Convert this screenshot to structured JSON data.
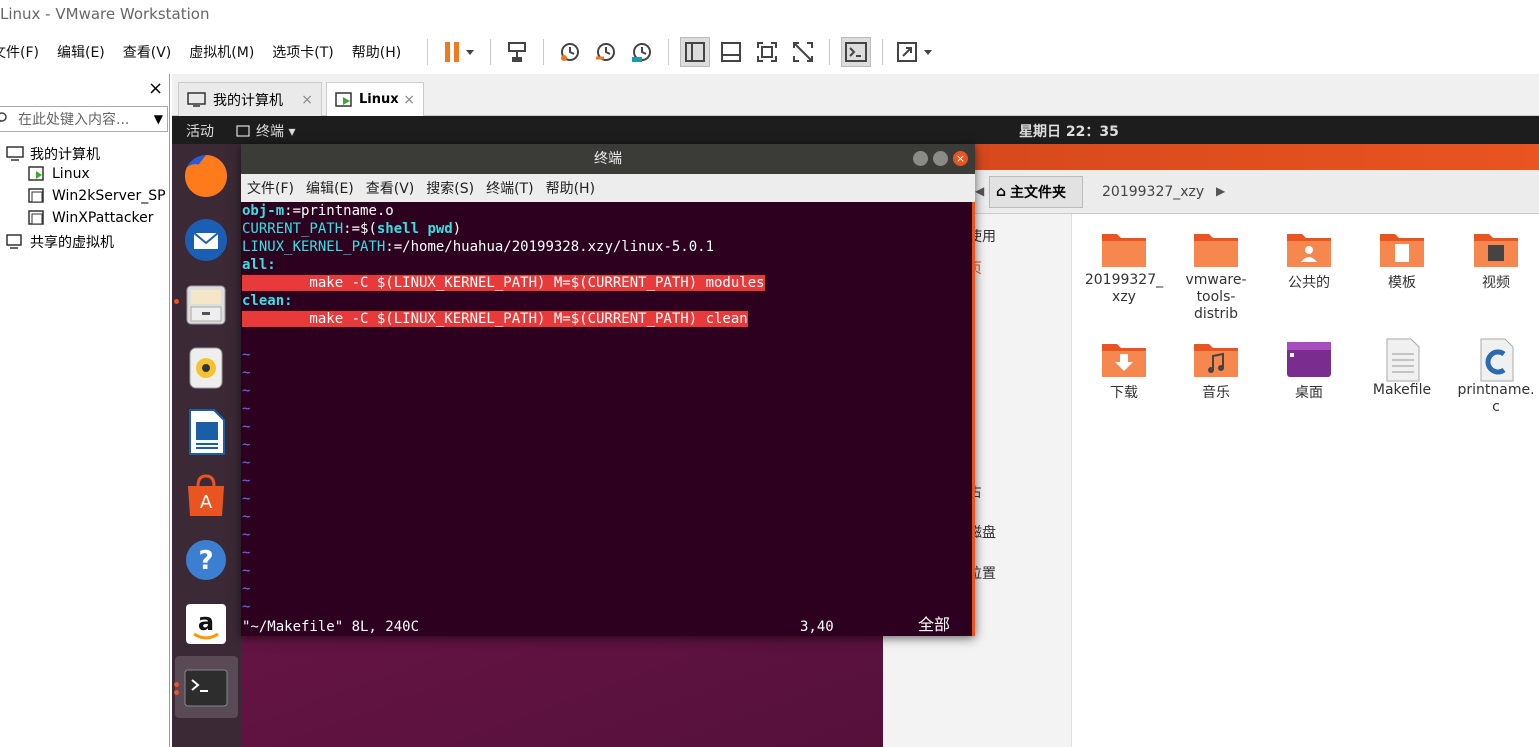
{
  "window": {
    "title": "Linux - VMware Workstation"
  },
  "menu": [
    "文件(F)",
    "编辑(E)",
    "查看(V)",
    "虚拟机(M)",
    "选项卡(T)",
    "帮助(H)"
  ],
  "library": {
    "close": "×",
    "search_placeholder": "在此处键入内容...",
    "items": [
      "我的计算机",
      "Linux",
      "Win2kServer_SP",
      "WinXPattacker",
      "共享的虚拟机"
    ]
  },
  "tabs": [
    {
      "label": "我的计算机",
      "close": "×"
    },
    {
      "label": "Linux",
      "close": "×"
    }
  ],
  "ubuntu": {
    "activities": "活动",
    "app_menu": "终端 ▾",
    "clock": "星期日 22：35"
  },
  "terminal": {
    "title": "终端",
    "menu": [
      "文件(F)",
      "编辑(E)",
      "查看(V)",
      "搜索(S)",
      "终端(T)",
      "帮助(H)"
    ],
    "lines": [
      {
        "parts": [
          {
            "t": "obj-m",
            "c": "kw"
          },
          {
            "t": ":=printname.o",
            "c": ""
          }
        ]
      },
      {
        "parts": [
          {
            "t": "CURRENT_PATH",
            "c": "vv"
          },
          {
            "t": ":=$(",
            "c": ""
          },
          {
            "t": "shell pwd",
            "c": "kw"
          },
          {
            "t": ")",
            "c": ""
          }
        ]
      },
      {
        "parts": [
          {
            "t": "LINUX_KERNEL_PATH",
            "c": "vv"
          },
          {
            "t": ":=/home/huahua/20199328.xzy/linux-5.0.1",
            "c": ""
          }
        ]
      },
      {
        "parts": [
          {
            "t": "all:",
            "c": "kw"
          }
        ]
      },
      {
        "parts": [
          {
            "t": "        make -C $(LINUX_KERNEL_PATH) M=$(CURRENT_PATH) modules",
            "c": "hl"
          }
        ]
      },
      {
        "parts": [
          {
            "t": "clean:",
            "c": "kw"
          }
        ]
      },
      {
        "parts": [
          {
            "t": "        make -C $(LINUX_KERNEL_PATH) M=$(CURRENT_PATH) clean",
            "c": "hl"
          }
        ]
      },
      {
        "parts": [
          {
            "t": "",
            "c": ""
          }
        ]
      }
    ],
    "tilde_count": 15,
    "status_file": "\"~/Makefile\" 8L, 240C",
    "status_pos": "3,40",
    "status_all": "全部"
  },
  "files": {
    "path_home": "主文件夹",
    "path_sub": "20199327_xzy",
    "sidebar_fragments": [
      "使用",
      "页",
      "占",
      "磁盘",
      "位置"
    ],
    "items": [
      {
        "name": "20199327_\nxzy",
        "kind": "folder"
      },
      {
        "name": "vmware-\ntools-\ndistrib",
        "kind": "folder"
      },
      {
        "name": "公共的",
        "kind": "folder-share"
      },
      {
        "name": "模板",
        "kind": "folder-template"
      },
      {
        "name": "视频",
        "kind": "folder-video"
      },
      {
        "name": "下载",
        "kind": "folder-download"
      },
      {
        "name": "音乐",
        "kind": "folder-music"
      },
      {
        "name": "桌面",
        "kind": "folder-desktop"
      },
      {
        "name": "Makefile",
        "kind": "text-file"
      },
      {
        "name": "printname.\nc",
        "kind": "c-file"
      }
    ]
  },
  "colors": {
    "ubuntu_orange": "#e95420",
    "terminal_bg": "#2c001e",
    "highlight": "#e83a3a"
  }
}
